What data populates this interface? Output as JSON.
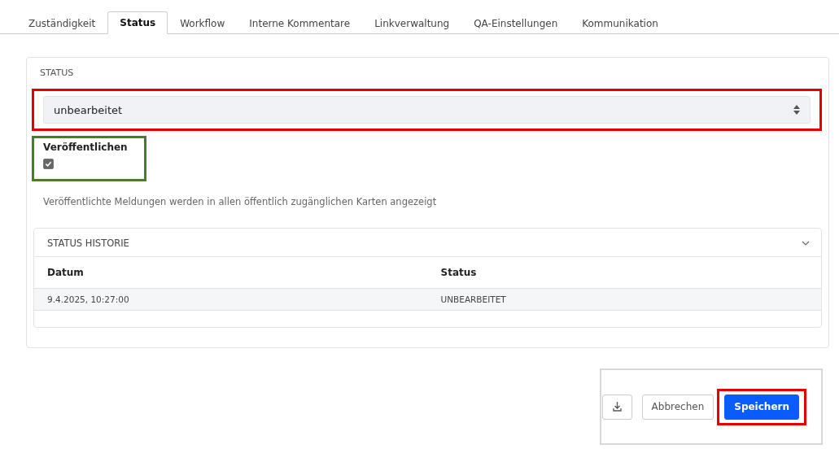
{
  "tabs": [
    {
      "label": "Zuständigkeit",
      "selected": false
    },
    {
      "label": "Status",
      "selected": true
    },
    {
      "label": "Workflow",
      "selected": false
    },
    {
      "label": "Interne Kommentare",
      "selected": false
    },
    {
      "label": "Linkverwaltung",
      "selected": false
    },
    {
      "label": "QA-Einstellungen",
      "selected": false
    },
    {
      "label": "Kommunikation",
      "selected": false
    }
  ],
  "status_section": {
    "title": "STATUS",
    "select": {
      "value": "unbearbeitet",
      "color": "#e60000"
    },
    "publish": {
      "label": "Veröffentlichen",
      "checked": true,
      "color": "#4a7a2e"
    },
    "hint": "Veröffentlichte Meldungen werden in allen öffentlich zugänglichen Karten angezeigt"
  },
  "history": {
    "title": "STATUS HISTORIE",
    "expanded": true,
    "columns": [
      "Datum",
      "Status"
    ],
    "rows": [
      [
        "9.4.2025, 10:27:00",
        "UNBEARBEITET"
      ]
    ]
  },
  "footer": {
    "cancel": "Abbrechen",
    "save": {
      "label": "Speichern",
      "color": "#e60000"
    }
  }
}
